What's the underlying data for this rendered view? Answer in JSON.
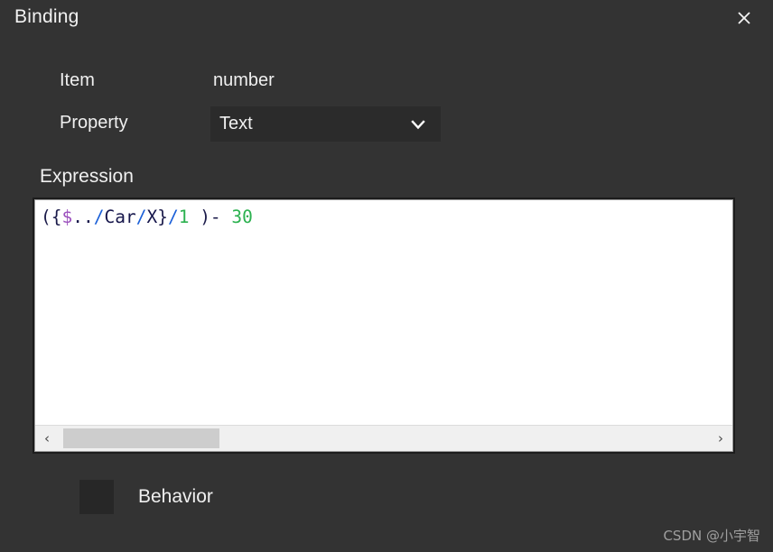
{
  "dialog": {
    "title": "Binding",
    "close_icon": "close-icon",
    "background_color": "#333333"
  },
  "form": {
    "item": {
      "label": "Item",
      "value": "number"
    },
    "property": {
      "label": "Property",
      "selected": "Text",
      "chevron_icon": "chevron-down-icon"
    }
  },
  "expression": {
    "label": "Expression",
    "value": "({$../Car/X}/1 )- 30",
    "tokens": [
      {
        "text": "({",
        "color": "#1b1b4a"
      },
      {
        "text": "$",
        "color": "#9b4fbd"
      },
      {
        "text": "..",
        "color": "#16164b"
      },
      {
        "text": "/",
        "color": "#1a5fd8"
      },
      {
        "text": "Car",
        "color": "#16164b"
      },
      {
        "text": "/",
        "color": "#1a5fd8"
      },
      {
        "text": "X",
        "color": "#16164b"
      },
      {
        "text": "}",
        "color": "#1b1b4a"
      },
      {
        "text": "/",
        "color": "#1a5fd8"
      },
      {
        "text": "1",
        "color": "#2bb14f"
      },
      {
        "text": " )- ",
        "color": "#1b1b4a"
      },
      {
        "text": "30",
        "color": "#2bb14f"
      }
    ],
    "scrollbar": {
      "left_arrow": "‹",
      "right_arrow": "›"
    }
  },
  "behavior": {
    "label": "Behavior",
    "checked": false
  },
  "watermark": "CSDN @小宇智"
}
